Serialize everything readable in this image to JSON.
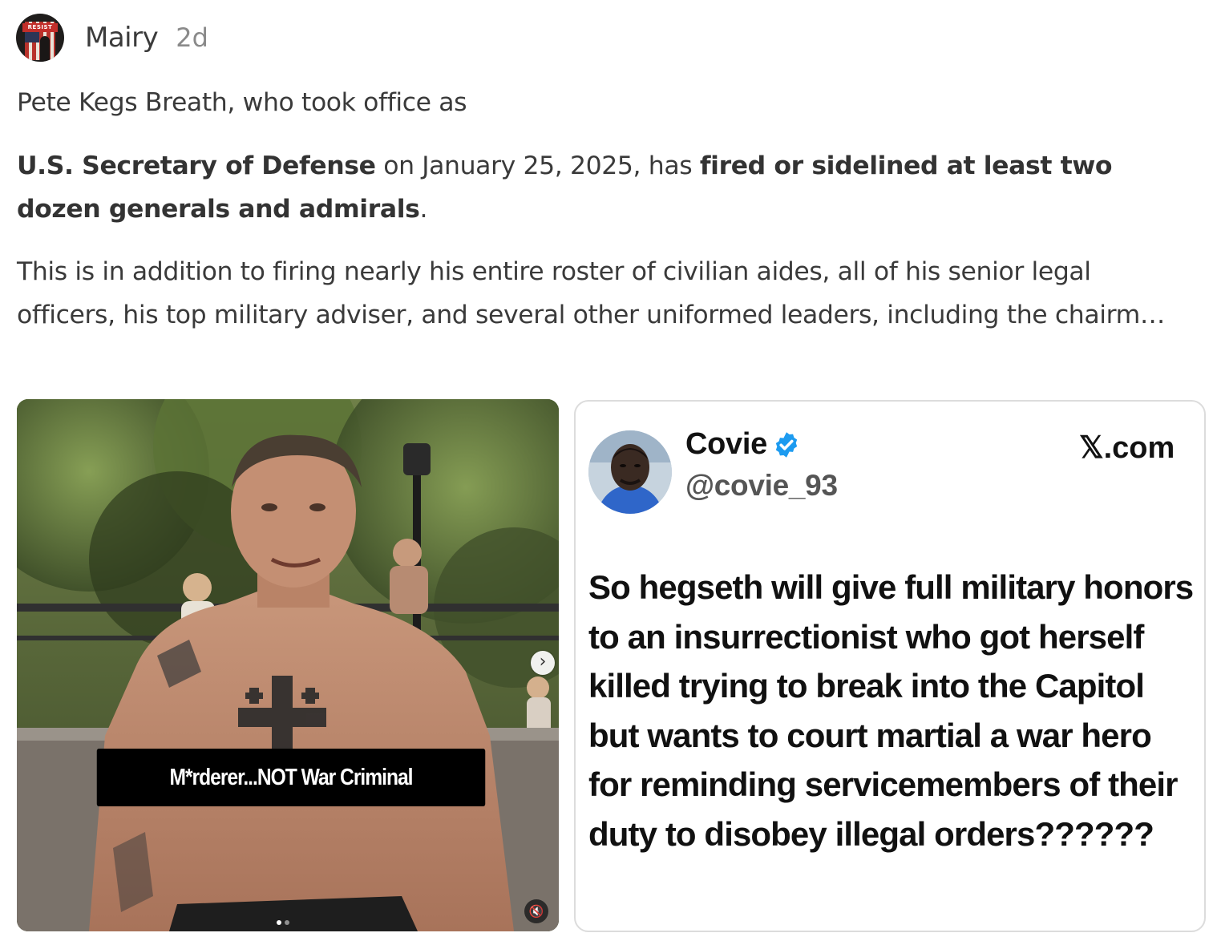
{
  "post": {
    "author": "Mairy",
    "timestamp": "2d",
    "avatar_icon": "resist-flag-avatar-icon",
    "avatar_badge": "RESIST"
  },
  "body": {
    "p1": "Pete Kegs Breath, who took office as",
    "p2_bold1": "U.S. Secretary of Defense",
    "p2_text1": " on January 25, 2025, has ",
    "p2_bold2": "fired or sidelined at least two dozen generals and admirals",
    "p2_text2": ".",
    "p3": "This is in addition to firing nearly his entire roster of civilian aides, all of his senior legal officers, his top military adviser, and several other uniformed leaders, including the chairm…"
  },
  "media_photo": {
    "caption": "M*rderer...NOT War Criminal",
    "next_icon": "chevron-right-icon",
    "mute_icon": "speaker-muted-icon",
    "slide_count": 2,
    "active_slide": 1
  },
  "tweet": {
    "name": "Covie",
    "handle": "@covie_93",
    "source": "𝕏.com",
    "verified_color": "#1d9bf0",
    "text": "So hegseth will give full military honors to an insurrectionist who got herself killed trying to break into the Capitol but wants to court martial a war hero for reminding servicemembers of their duty to disobey illegal orders??????"
  }
}
